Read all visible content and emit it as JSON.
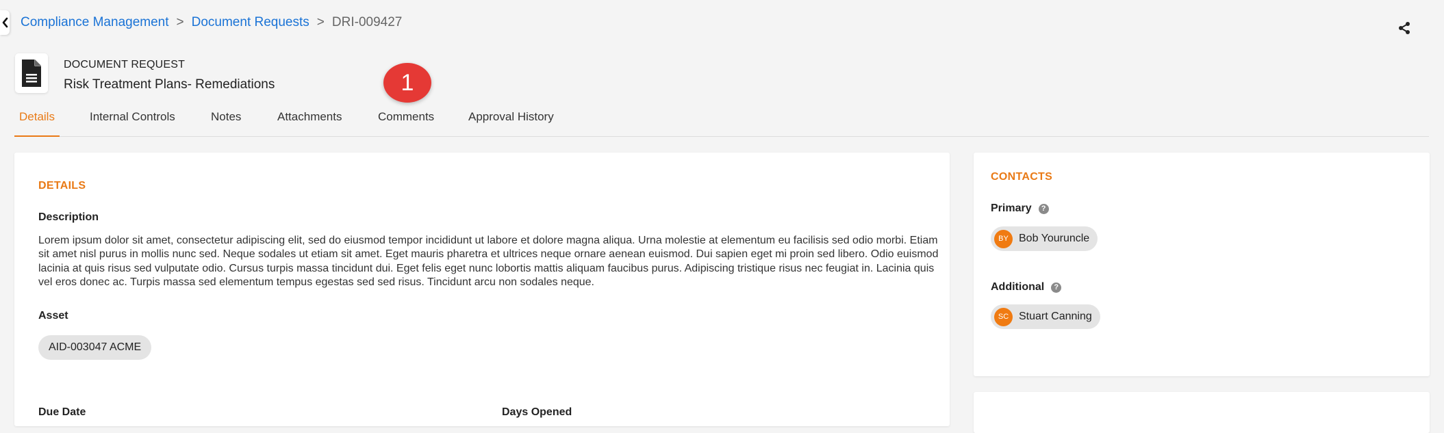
{
  "breadcrumb": {
    "items": [
      "Compliance Management",
      "Document Requests"
    ],
    "separator": ">",
    "current": "DRI-009427"
  },
  "header": {
    "type_label": "DOCUMENT REQUEST",
    "title": "Risk Treatment Plans- Remediations",
    "badge_count": "1"
  },
  "tabs": [
    {
      "label": "Details",
      "active": true
    },
    {
      "label": "Internal Controls",
      "active": false
    },
    {
      "label": "Notes",
      "active": false
    },
    {
      "label": "Attachments",
      "active": false
    },
    {
      "label": "Comments",
      "active": false
    },
    {
      "label": "Approval History",
      "active": false
    }
  ],
  "details": {
    "section_title": "DETAILS",
    "description_label": "Description",
    "description_text": "Lorem ipsum dolor sit amet, consectetur adipiscing elit, sed do eiusmod tempor incididunt ut labore et dolore magna aliqua. Urna molestie at elementum eu facilisis sed odio morbi. Etiam sit amet nisl purus in mollis nunc sed. Neque sodales ut etiam sit amet. Eget mauris pharetra et ultrices neque ornare aenean euismod. Dui sapien eget mi proin sed libero. Odio euismod lacinia at quis risus sed vulputate odio. Cursus turpis massa tincidunt dui. Eget felis eget nunc lobortis mattis aliquam faucibus purus. Adipiscing tristique risus nec feugiat in. Lacinia quis vel eros donec ac. Turpis massa sed elementum tempus egestas sed sed risus. Tincidunt arcu non sodales neque.",
    "asset_label": "Asset",
    "asset_value": "AID-003047 ACME",
    "due_date_label": "Due Date",
    "days_opened_label": "Days Opened"
  },
  "contacts": {
    "section_title": "CONTACTS",
    "primary_label": "Primary",
    "primary_initials": "BY",
    "primary_name": "Bob Youruncle",
    "additional_label": "Additional",
    "additional_initials": "SC",
    "additional_name": "Stuart Canning",
    "help_glyph": "?"
  },
  "colors": {
    "accent": "#e97a16",
    "link": "#1a73d6",
    "badge": "#e53935",
    "avatar": "#f07b12"
  },
  "icons": [
    "back-arrow-icon",
    "share-icon",
    "document-icon",
    "help-icon"
  ]
}
